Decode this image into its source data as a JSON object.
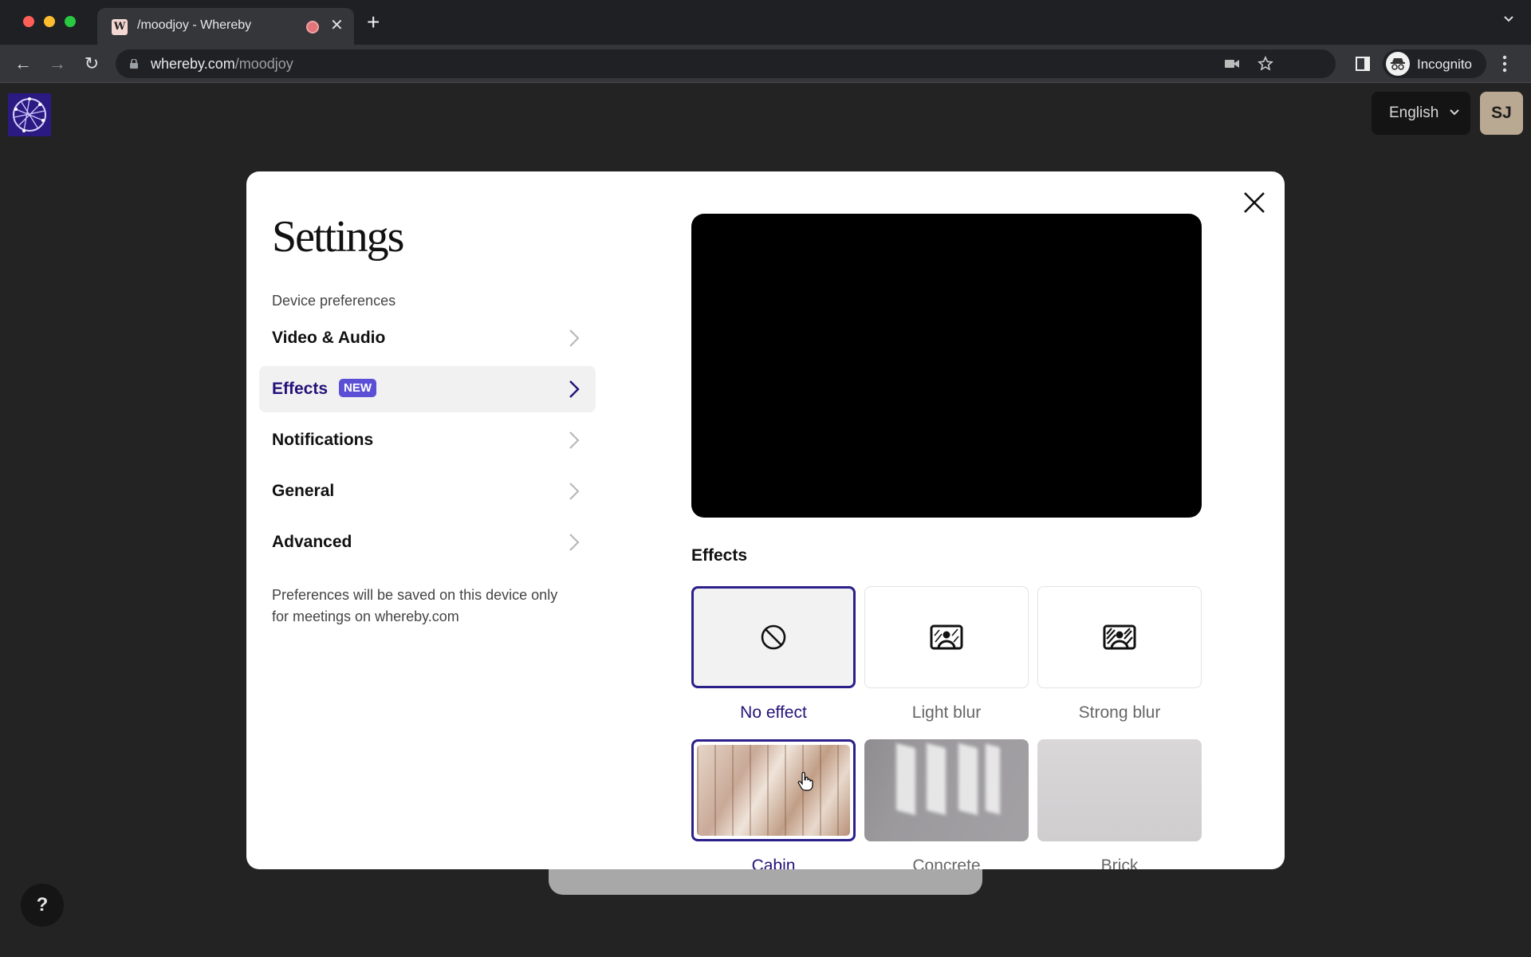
{
  "browser": {
    "tab": {
      "favicon_letter": "W",
      "title": "/moodjoy - Whereby",
      "recording_indicator": "record-icon"
    },
    "url": {
      "domain": "whereby.com",
      "path": "/moodjoy"
    },
    "profile_label": "Incognito",
    "icons": [
      "back-icon",
      "forward-icon",
      "reload-icon",
      "lock-icon",
      "camera-icon",
      "star-icon",
      "side-panel-icon",
      "incognito-icon",
      "kebab-menu-icon",
      "tab-list-icon",
      "new-tab-icon"
    ]
  },
  "page": {
    "language": "English",
    "user_initials": "SJ",
    "help_label": "?"
  },
  "settings_modal": {
    "title": "Settings",
    "section_label": "Device preferences",
    "nav_items": [
      {
        "label": "Video & Audio",
        "active": false
      },
      {
        "label": "Effects",
        "badge": "NEW",
        "active": true
      },
      {
        "label": "Notifications",
        "active": false
      },
      {
        "label": "General",
        "active": false
      },
      {
        "label": "Advanced",
        "active": false
      }
    ],
    "note": "Preferences will be saved on this device only for meetings on whereby.com",
    "effects_heading": "Effects",
    "effects": [
      {
        "label": "No effect",
        "icon": "no-effect-icon",
        "selected": true
      },
      {
        "label": "Light blur",
        "icon": "light-blur-icon",
        "selected": false
      },
      {
        "label": "Strong blur",
        "icon": "strong-blur-icon",
        "selected": false
      },
      {
        "label": "Cabin",
        "image": "cabin-background",
        "selected": true
      },
      {
        "label": "Concrete",
        "image": "concrete-background",
        "selected": false
      },
      {
        "label": "Brick",
        "image": "brick-background",
        "selected": false
      }
    ],
    "colors": {
      "accent": "#25117a",
      "badge": "#5b4fd6",
      "selected_border": "#2b1f8a"
    }
  }
}
